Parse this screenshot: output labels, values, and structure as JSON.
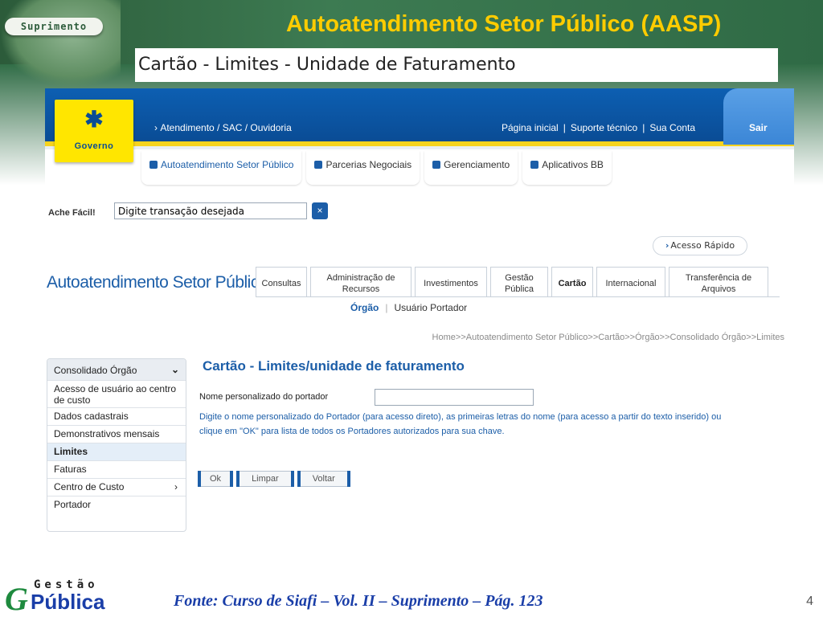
{
  "slide": {
    "brand": "Suprimento",
    "title": "Autoatendimento Setor Público (AASP)",
    "subtitle": "Cartão  - Limites - Unidade de Faturamento",
    "source": "Fonte: Curso de Siafi – Vol. II – Suprimento – Pág. 123",
    "page_number": "4",
    "footer_logo": {
      "g": "G",
      "gestao": "Gestão",
      "publica": "Pública"
    }
  },
  "header": {
    "logo_text": "Governo",
    "sac_link": "Atendimento / SAC / Ouvidoria",
    "top_links": [
      "Página inicial",
      "Suporte técnico",
      "Sua Conta"
    ],
    "sair": "Sair"
  },
  "nav": [
    "Autoatendimento Setor Público",
    "Parcerias Negociais",
    "Gerenciamento",
    "Aplicativos BB"
  ],
  "search": {
    "label": "Ache Fácil!",
    "value": "Digite transação desejada",
    "button": "×"
  },
  "acesso_rapido": "Acesso Rápido",
  "aasp_title": "Autoatendimento Setor Público",
  "tabs": [
    {
      "label": "Consultas",
      "active": false
    },
    {
      "label": "Administração de Recursos",
      "active": false
    },
    {
      "label": "Investimentos",
      "active": false
    },
    {
      "label": "Gestão Pública",
      "active": false
    },
    {
      "label": "Cartão",
      "active": true
    },
    {
      "label": "Internacional",
      "active": false
    },
    {
      "label": "Transferência de Arquivos",
      "active": false
    }
  ],
  "subtabs": {
    "orgao": "Órgão",
    "usuario": "Usuário Portador"
  },
  "breadcrumb": "Home>>Autoatendimento Setor Público>>Cartão>>Órgão>>Consolidado Órgão>>Limites",
  "sidebar": {
    "header": "Consolidado Órgão",
    "items": [
      "Acesso de usuário ao centro de custo",
      "Dados cadastrais",
      "Demonstrativos mensais",
      "Limites",
      "Faturas",
      "Centro de Custo",
      "Portador"
    ]
  },
  "content": {
    "title": "Cartão - Limites/unidade de faturamento",
    "field_label": "Nome personalizado do portador",
    "field_value": "",
    "help": "Digite o nome personalizado do Portador (para acesso direto), as primeiras letras do nome (para acesso a partir do texto inserido) ou clique em \"OK\" para lista de todos os Portadores autorizados para sua chave.",
    "buttons": {
      "ok": "Ok",
      "limpar": "Limpar",
      "voltar": "Voltar"
    }
  },
  "colors": {
    "bb_blue": "#0a4c95",
    "bb_yellow": "#ffe600",
    "title_yellow": "#ffcc00",
    "link_blue": "#1c5ea8"
  }
}
